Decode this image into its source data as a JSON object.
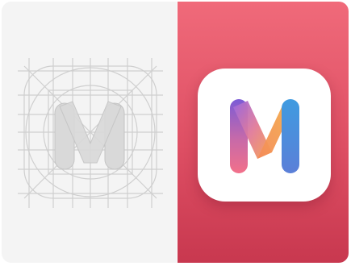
{
  "left_panel": {
    "illustration": "icon-construction-grid",
    "background": "#f4f4f4",
    "line_color": "#cfcfcf",
    "glyph_fill": "#d9d9d9"
  },
  "right_panel": {
    "illustration": "m-app-icon",
    "gradient_top": "#f06a7a",
    "gradient_bottom": "#c8384f",
    "icon_background": "#ffffff",
    "glyph_colors": {
      "left_stroke_top": "#7b5bd6",
      "left_stroke_bottom": "#f2708a",
      "middle_top": "#9b6ae0",
      "middle_bottom": "#f7a14a",
      "right_stroke_top": "#3f9be0",
      "right_stroke_bottom": "#5b7fd8"
    }
  }
}
